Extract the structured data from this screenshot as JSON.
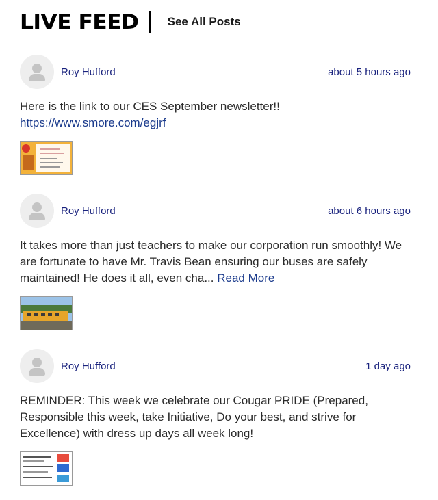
{
  "header": {
    "title": "LIVE FEED",
    "see_all": "See All Posts"
  },
  "posts": [
    {
      "author": "Roy Hufford",
      "time": "about 5 hours ago",
      "text": "Here is the link to our CES September newsletter!!",
      "link": "https://www.smore.com/egjrf",
      "read_more": ""
    },
    {
      "author": "Roy Hufford",
      "time": "about 6 hours ago",
      "text": "It takes more than just teachers to make our corporation run smoothly! We are fortunate to have Mr. Travis Bean ensuring our buses are safely maintained! He does it all, even cha... ",
      "link": "",
      "read_more": "Read More"
    },
    {
      "author": "Roy Hufford",
      "time": "1 day ago",
      "text": "REMINDER: This week we celebrate our Cougar PRIDE (Prepared, Responsible this week, take Initiative, Do your best, and strive for Excellence) with dress up days all week long!",
      "link": "",
      "read_more": ""
    }
  ],
  "colors": {
    "link": "#1a237e",
    "text": "#2b2b2b",
    "avatar_bg": "#eeeeee",
    "avatar_fg": "#c4c4c4"
  },
  "icons": {
    "avatar": "user-silhouette-icon"
  }
}
